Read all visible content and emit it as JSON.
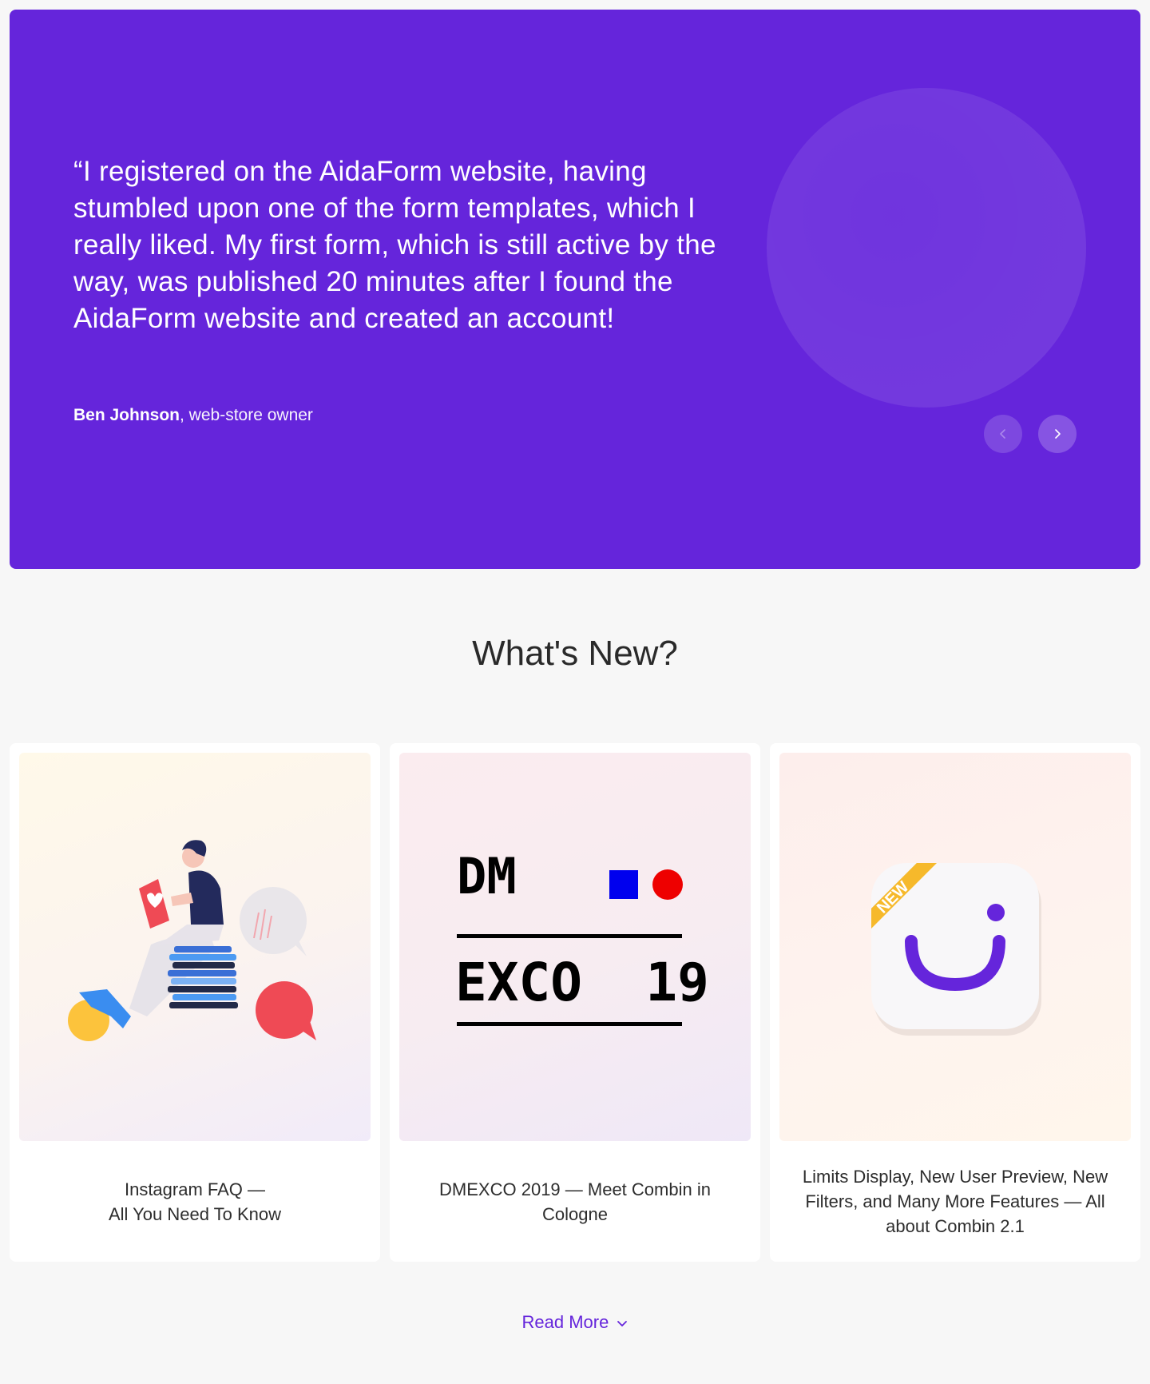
{
  "testimonial": {
    "quote": "“I registered on the AidaForm website, having stumbled upon one of the form templates, which I really liked. My first form, which is still active by the way, was published 20 minutes after I found the AidaForm website and created an account!",
    "author_name": "Ben Johnson",
    "author_role": ", web-store owner",
    "prev_icon": "chevron-left-icon",
    "next_icon": "chevron-right-icon",
    "accent_color": "#6525db"
  },
  "whats_new": {
    "title": "What's New?",
    "cards": [
      {
        "caption": "Instagram FAQ —\nAll You Need To Know",
        "image": "reader-illustration"
      },
      {
        "caption": "DMEXCO 2019 — Meet Combin in Cologne",
        "image": "dmexco-logo",
        "logo_line1": "DM",
        "logo_line2": "EXCO  19"
      },
      {
        "caption": "Limits Display, New User Preview, New Filters, and Many More Features — All about Combin 2.1",
        "image": "combin-app-icon",
        "badge": "NEW"
      }
    ],
    "read_more_label": "Read More",
    "read_more_icon": "chevron-down-icon"
  }
}
